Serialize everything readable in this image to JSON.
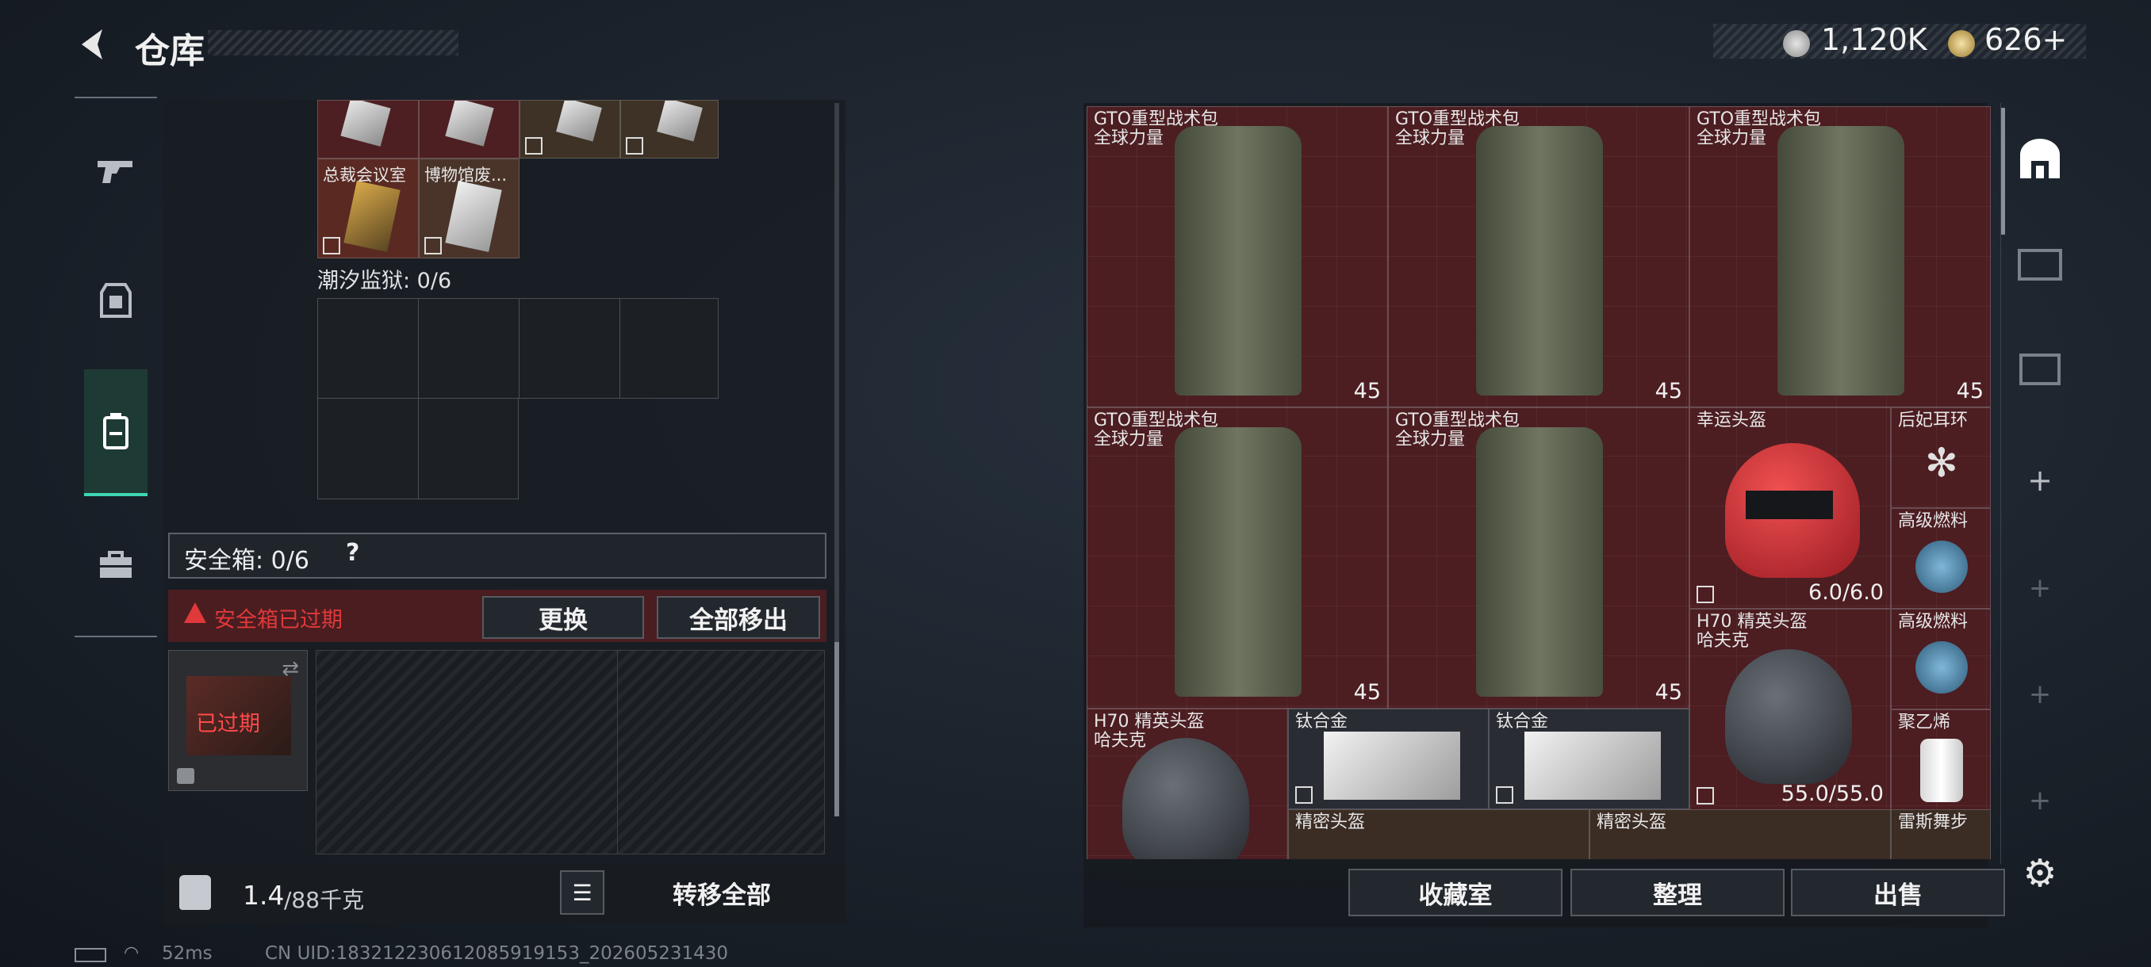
{
  "header": {
    "title": "仓库",
    "currency1": "1,120K",
    "currency2": "626+"
  },
  "left": {
    "top_labels": [
      "总裁会议室",
      "博物馆废..."
    ],
    "tide_prison": "潮汐监狱: 0/6",
    "safebox": {
      "label": "安全箱: 0/6",
      "help": "?",
      "expired_warning": "安全箱已过期",
      "replace": "更换",
      "move_all_out": "全部移出",
      "expired_badge": "已过期"
    },
    "weight": {
      "current": "1.4",
      "max": "/88千克"
    },
    "transfer_all": "转移全部"
  },
  "items": {
    "bag_name": "GTO重型战术包",
    "bag_sub": "全球力量",
    "bag_count": "45",
    "lucky_helmet": "幸运头盔",
    "lucky_helmet_dur": "6.0/6.0",
    "earring": "后妃耳环",
    "fuel": "高级燃料",
    "h70_name": "H70 精英头盔",
    "h70_sub": "哈夫克",
    "h70_dur": "55.0/55.0",
    "titanium": "钛合金",
    "polyethylene": "聚乙烯",
    "precision_helmet": "精密头盔",
    "rhes": "雷斯舞步"
  },
  "bottom_buttons": {
    "collection": "收藏室",
    "organize": "整理",
    "sell": "出售"
  },
  "status": {
    "ping": "52ms",
    "uid": "CN UID:18321223061208591915​3_202605231430"
  },
  "colors": {
    "expired_red": "#e0393b",
    "item_bg": "#4c1d21",
    "panel_bg": "#1e2329"
  }
}
